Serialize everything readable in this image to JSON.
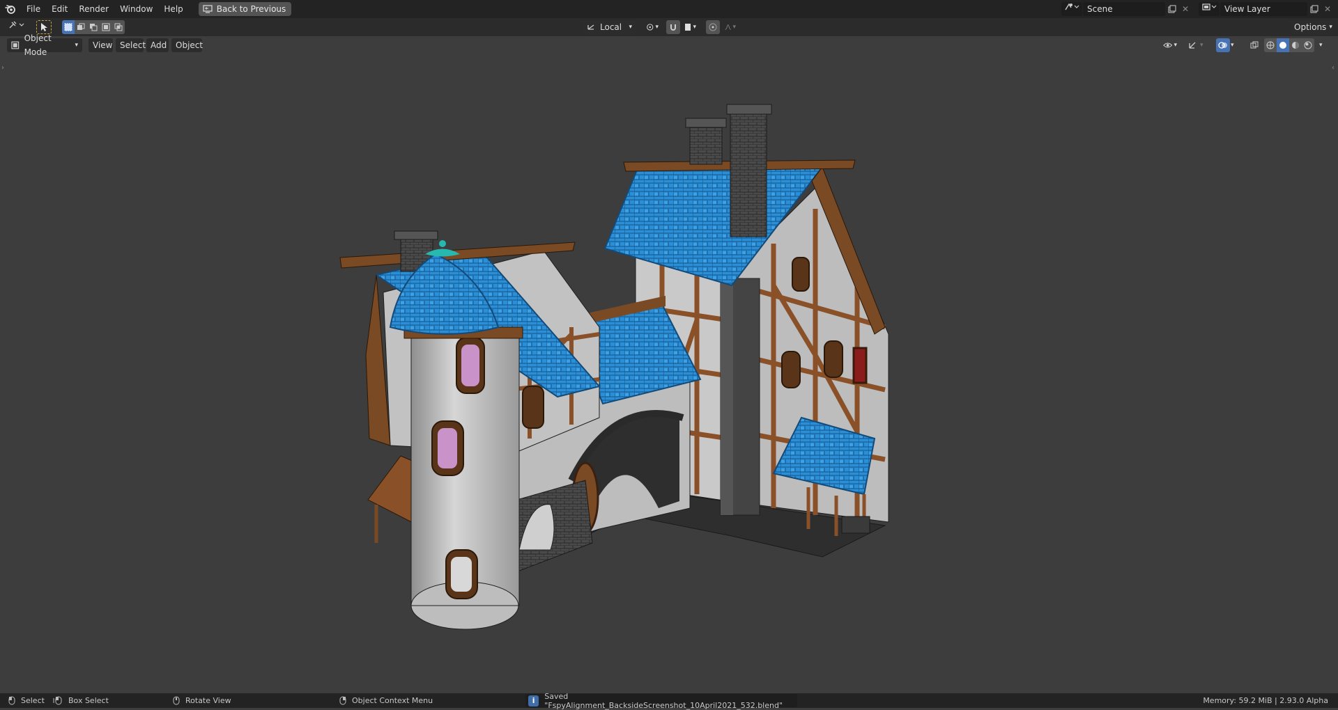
{
  "menu": [
    "File",
    "Edit",
    "Render",
    "Window",
    "Help"
  ],
  "back_button": "Back to Previous",
  "scene": {
    "label": "Scene"
  },
  "view_layer": {
    "label": "View Layer"
  },
  "toolbar": {
    "transform_orientation": "Local",
    "options_label": "Options"
  },
  "viewport_header": {
    "mode": "Object Mode",
    "menus": [
      "View",
      "Select",
      "Add",
      "Object"
    ]
  },
  "status": {
    "select": "Select",
    "box_select": "Box Select",
    "rotate_view": "Rotate View",
    "context_menu": "Object Context Menu",
    "saved_message": "Saved \"FspyAlignment_BacksideScreenshot_10April2021_532.blend\"",
    "memory": "Memory: 59.2 MiB | 2.93.0 Alpha"
  },
  "colors": {
    "accent": "#4772b3",
    "roof_blue": "#2a8fd6",
    "wood": "#8a5028",
    "viewport_bg": "#3d3d3d"
  }
}
